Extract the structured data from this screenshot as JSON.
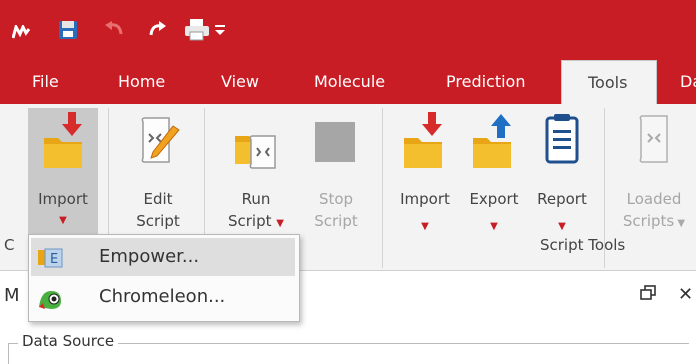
{
  "tabs": [
    "File",
    "Home",
    "View",
    "Molecule",
    "Prediction",
    "Tools",
    "Da"
  ],
  "ribbon": {
    "import_main": {
      "line1": "Import"
    },
    "edit_script": {
      "line1": "Edit",
      "line2": "Script"
    },
    "run_script": {
      "line1": "Run",
      "line2": "Script"
    },
    "stop_script": {
      "line1": "Stop",
      "line2": "Script"
    },
    "import": {
      "line1": "Import"
    },
    "export": {
      "line1": "Export"
    },
    "report": {
      "line1": "Report"
    },
    "loaded_scripts": {
      "line1": "Loaded",
      "line2": "Scripts"
    },
    "group_left": "C",
    "group_script_tools": "Script Tools"
  },
  "menu": {
    "items": [
      {
        "label": "Empower...",
        "icon": "empower-icon"
      },
      {
        "label": "Chromeleon...",
        "icon": "chromeleon-icon"
      }
    ]
  },
  "panel": {
    "title_letter": "M",
    "data_source_label": "Data Source"
  },
  "colors": {
    "accent": "#c81d25",
    "ribbon_bg": "#f3f3f3",
    "folder": "#f2b51c",
    "arrow_red": "#d72b2b",
    "arrow_blue": "#1f6fc4"
  }
}
